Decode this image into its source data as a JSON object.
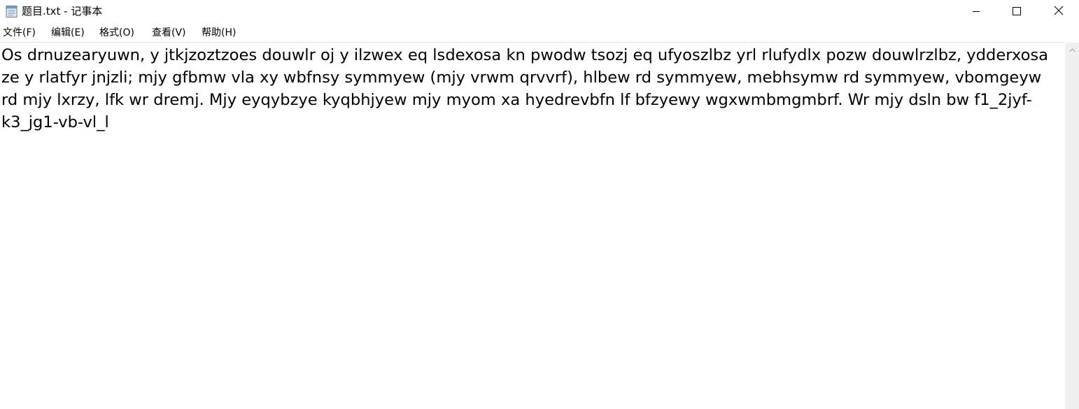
{
  "window": {
    "title": "题目.txt - 记事本",
    "minimize_icon": "minimize-icon",
    "maximize_icon": "maximize-icon",
    "close_icon": "close-icon",
    "app_icon": "notepad-icon"
  },
  "menu": {
    "file": "文件(F)",
    "edit": "编辑(E)",
    "format": "格式(O)",
    "view": "查看(V)",
    "help": "帮助(H)"
  },
  "editor": {
    "content": "Os drnuzearyuwn, y jtkjzoztzoes douwlr oj y ilzwex eq lsdexosa kn pwodw tsozj eq ufyoszlbz yrl rlufydlx pozw douwlrzlbz, ydderxosa ze y rlatfyr jnjzli; mjy gfbmw vla xy wbfnsy symmyew (mjy vrwm qrvvrf), hlbew rd symmyew, mebhsymw rd symmyew, vbomgeyw rd mjy lxrzy, lfk wr dremj. Mjy eyqybzye kyqbhjyew mjy myom xa hyedrevbfn lf bfzyewy wgxwmbmgmbrf. Wr mjy dsln bw f1_2jyf-k3_jg1-vb-vl_l"
  },
  "scrollbar": {
    "up_icon": "scroll-up-arrow-icon"
  }
}
